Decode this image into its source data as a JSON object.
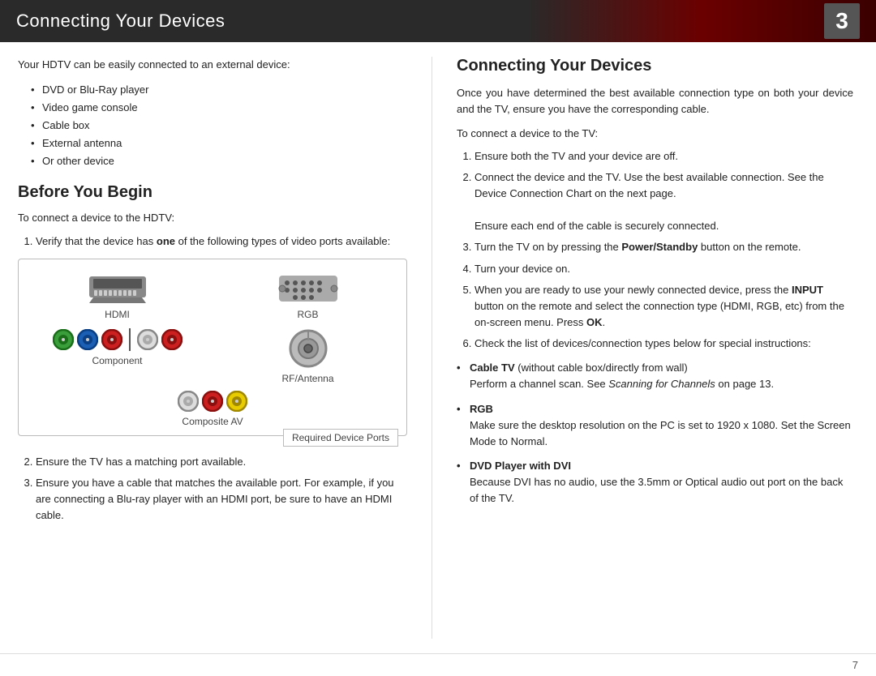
{
  "header": {
    "title": "Connecting Your Devices",
    "page_number": "3"
  },
  "left": {
    "intro": "Your HDTV can be easily connected to an external device:",
    "bullets": [
      "DVD or Blu-Ray player",
      "Video game console",
      "Cable box",
      "External antenna",
      "Or other device"
    ],
    "section_heading": "Before You Begin",
    "step_intro": "To connect a device to the HDTV:",
    "step1": "Verify that the device has one of the following types of video ports available:",
    "step1_bold": "one",
    "step2": "Ensure the TV has a matching port available.",
    "step3": "Ensure you have a cable that matches the available port. For example, if you are connecting a Blu-ray player with an HDMI port, be sure to have an HDMI cable.",
    "device_ports": {
      "caption": "Required Device Ports",
      "items": [
        {
          "name": "HDMI",
          "type": "hdmi"
        },
        {
          "name": "RGB",
          "type": "rgb"
        },
        {
          "name": "Component",
          "type": "component"
        },
        {
          "name": "RF/Antenna",
          "type": "rf"
        },
        {
          "name": "Composite AV",
          "type": "composite"
        }
      ]
    }
  },
  "right": {
    "heading": "Connecting Your Devices",
    "intro": "Once you have determined the best available connection type on both your device and the TV, ensure you have the corresponding cable.",
    "step_intro": "To connect a device to the TV:",
    "steps": [
      "Ensure both the TV and your device are off.",
      "Connect the device and the TV. Use the best available connection. See the Device Connection Chart on the next page.\n\nEnsure each end of the cable is securely connected.",
      "Turn the TV on by pressing the Power/Standby button on the remote.",
      "Turn your device on.",
      "When you are ready to use your newly connected device, press the INPUT button on the remote and select the connection type (HDMI, RGB, etc) from the on-screen menu. Press OK.",
      "Check the list of devices/connection types below for special instructions:"
    ],
    "special_items": [
      {
        "title": "Cable TV",
        "title_suffix": " (without cable box/directly from wall)",
        "body": "Perform a channel scan. See Scanning for Channels on page 13."
      },
      {
        "title": "RGB",
        "body": "Make sure the desktop resolution on the PC is set to 1920 x 1080. Set the Screen Mode to Normal."
      },
      {
        "title": "DVD Player with DVI",
        "body": "Because DVI has no audio, use the 3.5mm or Optical audio out port on the back of the TV."
      }
    ]
  },
  "footer": {
    "page_number": "7"
  }
}
